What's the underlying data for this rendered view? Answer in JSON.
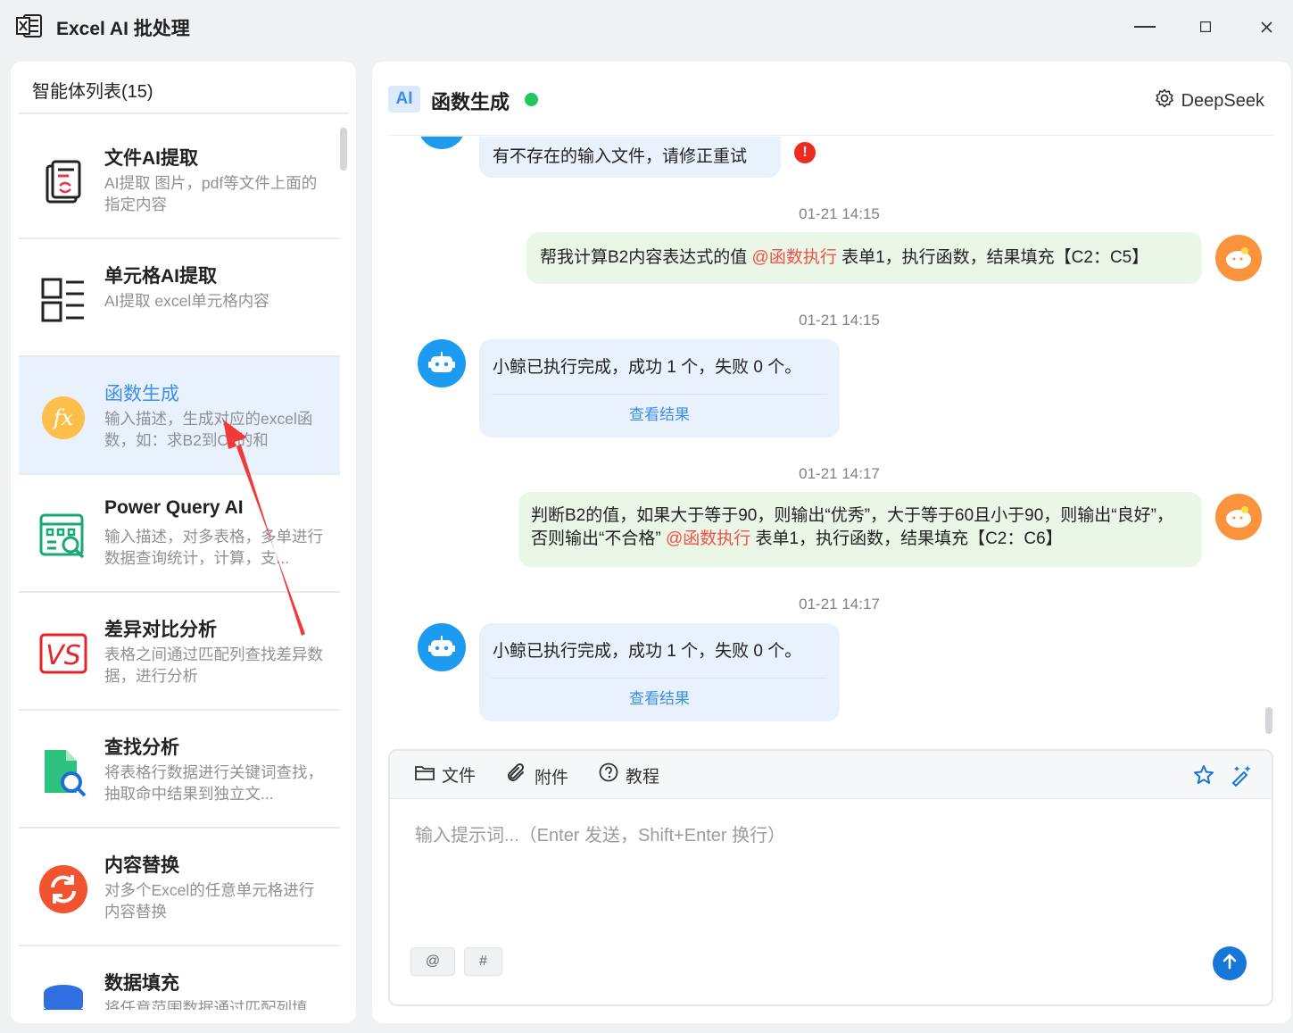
{
  "app": {
    "title": "Excel AI 批处理",
    "logo_icon": "excel-logo-icon"
  },
  "window_controls": [
    "minimize-icon",
    "maximize-icon",
    "close-icon"
  ],
  "sidebar": {
    "header": "智能体列表(15)",
    "items": [
      {
        "name": "文件AI提取",
        "desc": "AI提取 图片，pdf等文件上面的指定内容",
        "icon": "document-extract-icon",
        "selected": false
      },
      {
        "name": "单元格AI提取",
        "desc": "AI提取 excel单元格内容",
        "icon": "cell-grid-icon",
        "selected": false
      },
      {
        "name": "函数生成",
        "desc": "输入描述，生成对应的excel函数，如：求B2到C2的和",
        "icon": "function-fx-icon",
        "selected": true
      },
      {
        "name": "Power Query AI",
        "desc": "输入描述，对多表格，多单进行数据查询统计，计算，支...",
        "icon": "power-query-icon",
        "selected": false
      },
      {
        "name": "差异对比分析",
        "desc": "表格之间通过匹配列查找差异数据，进行分析",
        "icon": "vs-compare-icon",
        "selected": false
      },
      {
        "name": "查找分析",
        "desc": "将表格行数据进行关键词查找，抽取命中结果到独立文...",
        "icon": "search-file-icon",
        "selected": false
      },
      {
        "name": "内容替换",
        "desc": "对多个Excel的任意单元格进行内容替换",
        "icon": "replace-refresh-icon",
        "selected": false
      },
      {
        "name": "数据填充",
        "desc": "将任意范围数据通过匹配列填",
        "icon": "database-icon",
        "selected": false
      }
    ]
  },
  "chat": {
    "badge": "AI",
    "title": "函数生成",
    "status_color": "#22c55e",
    "model": "DeepSeek",
    "model_icon": "settings-gear-icon",
    "messages": [
      {
        "role": "bot",
        "text": "有不存在的输入文件，请修正重试",
        "error": "!"
      },
      {
        "role": "time",
        "text": "01-21 14:15"
      },
      {
        "role": "user",
        "pre": "帮我计算B2内容表达式的值 ",
        "mention": "@函数执行",
        "post": " 表单1，执行函数，结果填充【C2：C5】"
      },
      {
        "role": "time",
        "text": "01-21 14:15"
      },
      {
        "role": "bot",
        "text": "小鲸已执行完成，成功 1 个，失败 0 个。",
        "link": "查看结果"
      },
      {
        "role": "time",
        "text": "01-21 14:17"
      },
      {
        "role": "user",
        "pre": "判断B2的值，如果大于等于90，则输出“优秀”，大于等于60且小于90，则输出“良好”，否则输出“不合格” ",
        "mention": "@函数执行",
        "post": " 表单1，执行函数，结果填充【C2：C6】"
      },
      {
        "role": "time",
        "text": "01-21 14:17"
      },
      {
        "role": "bot",
        "text": "小鲸已执行完成，成功 1 个，失败 0 个。",
        "link": "查看结果"
      }
    ]
  },
  "input": {
    "toolbar": {
      "file_label": "文件",
      "attach_label": "附件",
      "tutorial_label": "教程"
    },
    "placeholder": "输入提示词...（Enter 发送，Shift+Enter 换行）",
    "chip_at": "@",
    "chip_hash": "#"
  },
  "colors": {
    "accent": "#3b8ef0",
    "mention": "#f1504a",
    "send": "#1677d9",
    "annotation_arrow": "#f03a3a"
  }
}
